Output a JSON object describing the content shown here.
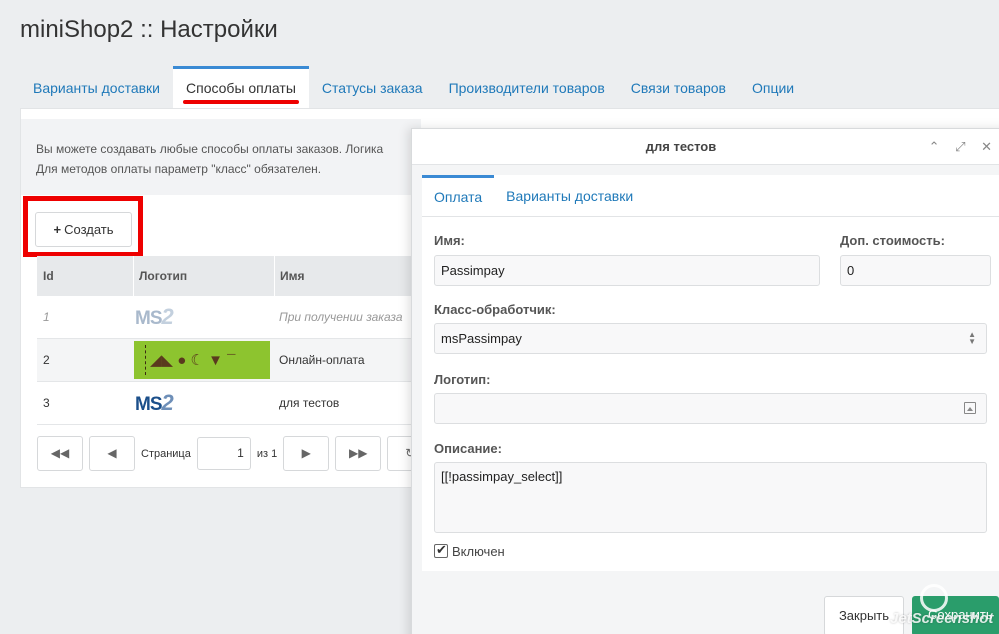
{
  "page": {
    "title": "miniShop2 :: Настройки"
  },
  "tabs": [
    {
      "label": "Варианты доставки"
    },
    {
      "label": "Способы оплаты"
    },
    {
      "label": "Статусы заказа"
    },
    {
      "label": "Производители товаров"
    },
    {
      "label": "Связи товаров"
    },
    {
      "label": "Опции"
    }
  ],
  "description": {
    "line1": "Вы можете создавать любые способы оплаты заказов. Логика",
    "line2": "Для методов оплаты параметр \"класс\" обязателен."
  },
  "toolbar": {
    "create_label": "Создать"
  },
  "grid": {
    "headers": {
      "id": "Id",
      "logo": "Логотип",
      "name": "Имя"
    },
    "rows": [
      {
        "id": "1",
        "name": "При получении заказа",
        "logo": "ms2",
        "active": false
      },
      {
        "id": "2",
        "name": "Онлайн-оплата",
        "logo": "green",
        "active": true
      },
      {
        "id": "3",
        "name": "для тестов",
        "logo": "ms2",
        "active": true
      }
    ],
    "logo_text": {
      "ms": "MS",
      "two": "2",
      "green_glyphs": "◢◣ ● ☾ ▼ ¯"
    }
  },
  "pager": {
    "page_label": "Страница",
    "page_value": "1",
    "of_label": "из 1"
  },
  "window": {
    "title": "для тестов",
    "controls": "⌃ ⤢ ✕",
    "tabs": [
      {
        "label": "Оплата"
      },
      {
        "label": "Варианты доставки"
      }
    ],
    "fields": {
      "name": {
        "label": "Имя:",
        "value": "Passimpay"
      },
      "price": {
        "label": "Доп. стоимость:",
        "value": "0"
      },
      "class": {
        "label": "Класс-обработчик:",
        "value": "msPassimpay"
      },
      "logo": {
        "label": "Логотип:",
        "value": ""
      },
      "description": {
        "label": "Описание:",
        "value": "[[!passimpay_select]]"
      },
      "active": {
        "label": "Включен",
        "checked": true
      }
    },
    "buttons": {
      "close": "Закрыть",
      "save": "Сохранить"
    }
  },
  "watermark": {
    "text": "JetScreenshot"
  },
  "colors": {
    "accent": "#1f79b9",
    "highlight": "#ee0000",
    "save": "#2a9d6b",
    "logo_green": "#8dc42f"
  }
}
